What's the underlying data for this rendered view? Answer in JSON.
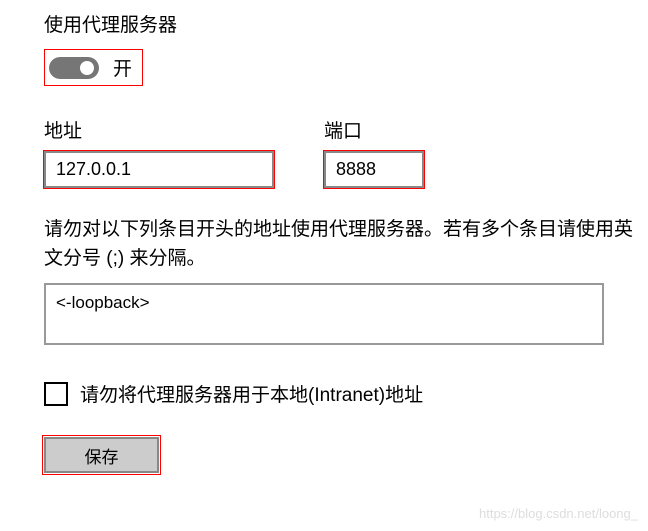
{
  "proxy": {
    "section_title": "使用代理服务器",
    "toggle_state": "开",
    "address_label": "地址",
    "address_value": "127.0.0.1",
    "port_label": "端口",
    "port_value": "8888",
    "exception_instruction": "请勿对以下列条目开头的地址使用代理服务器。若有多个条目请使用英文分号 (;) 来分隔。",
    "exception_value": "<-loopback>",
    "intranet_checkbox_label": "请勿将代理服务器用于本地(Intranet)地址",
    "save_button_label": "保存"
  },
  "watermark": "https://blog.csdn.net/loong_"
}
